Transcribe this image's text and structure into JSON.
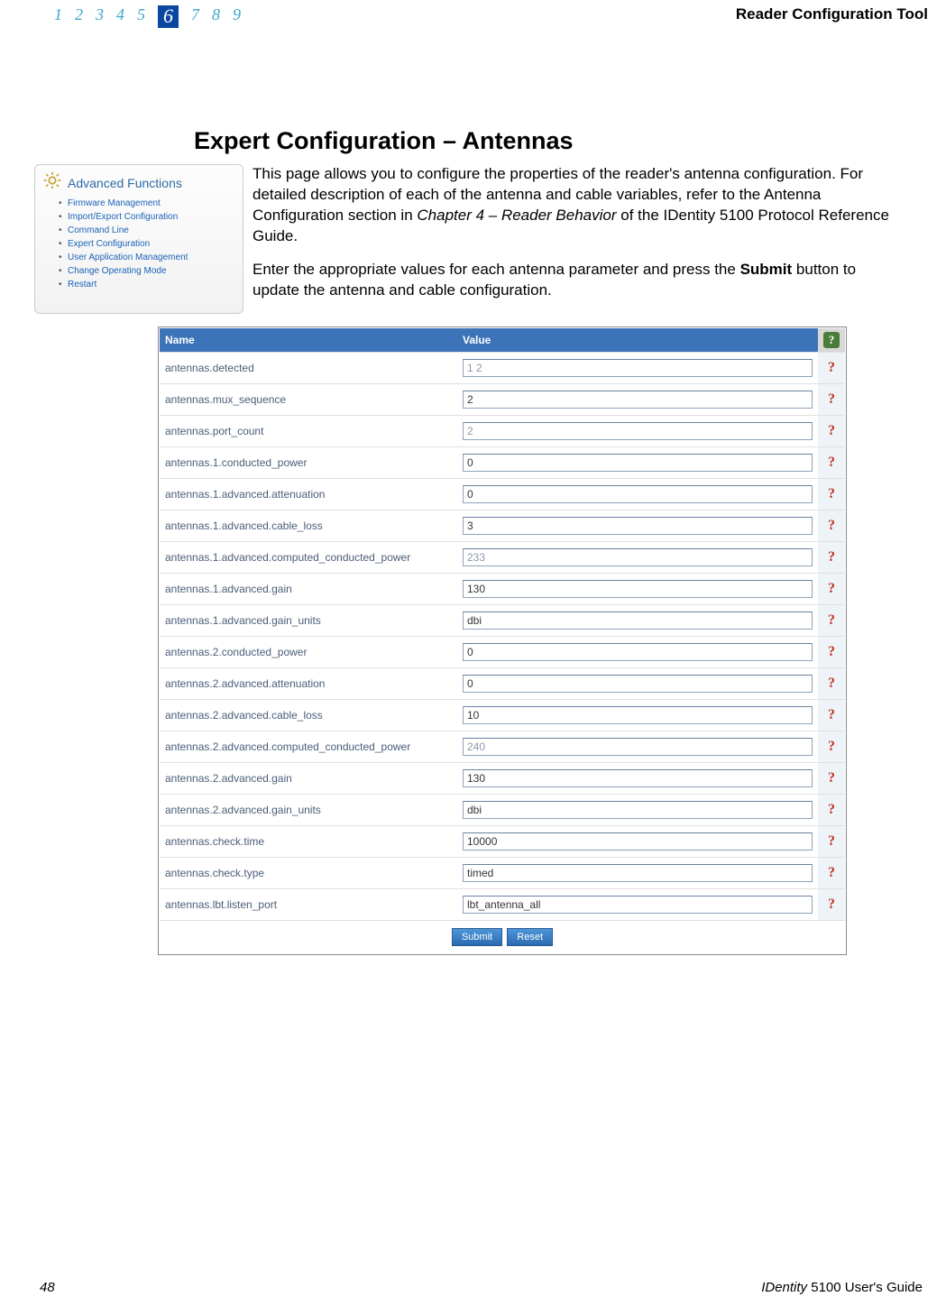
{
  "header": {
    "chapters": [
      "1",
      "2",
      "3",
      "4",
      "5",
      "6",
      "7",
      "8",
      "9"
    ],
    "current_chapter_index": 5,
    "title": "Reader Configuration Tool"
  },
  "section_title": "Expert Configuration – Antennas",
  "intro": {
    "p1_a": "This page allows you to configure the properties of the reader's antenna configuration. For detailed description of each of the antenna and cable variables, refer to the Antenna Configuration section in ",
    "p1_b": "Chapter 4 – Reader Behavior",
    "p1_c": " of the ",
    "p1_d": "IDentity 5100 Protocol Reference Guide",
    "p1_e": ".",
    "p2_a": "Enter the appropriate values for each antenna parameter and press the ",
    "p2_b": "Submit",
    "p2_c": " button to update the antenna and cable configuration."
  },
  "sidebar": {
    "title": "Advanced Functions",
    "items": [
      "Firmware Management",
      "Import/Export Configuration",
      "Command Line",
      "Expert Configuration",
      "User Application Management",
      "Change Operating Mode",
      "Restart"
    ]
  },
  "table": {
    "col_name": "Name",
    "col_value": "Value",
    "rows": [
      {
        "name": "antennas.detected",
        "value": "1 2",
        "readonly": true
      },
      {
        "name": "antennas.mux_sequence",
        "value": "2",
        "readonly": false
      },
      {
        "name": "antennas.port_count",
        "value": "2",
        "readonly": true
      },
      {
        "name": "antennas.1.conducted_power",
        "value": "0",
        "readonly": false
      },
      {
        "name": "antennas.1.advanced.attenuation",
        "value": "0",
        "readonly": false
      },
      {
        "name": "antennas.1.advanced.cable_loss",
        "value": "3",
        "readonly": false
      },
      {
        "name": "antennas.1.advanced.computed_conducted_power",
        "value": "233",
        "readonly": true
      },
      {
        "name": "antennas.1.advanced.gain",
        "value": "130",
        "readonly": false
      },
      {
        "name": "antennas.1.advanced.gain_units",
        "value": "dbi",
        "readonly": false
      },
      {
        "name": "antennas.2.conducted_power",
        "value": "0",
        "readonly": false
      },
      {
        "name": "antennas.2.advanced.attenuation",
        "value": "0",
        "readonly": false
      },
      {
        "name": "antennas.2.advanced.cable_loss",
        "value": "10",
        "readonly": false
      },
      {
        "name": "antennas.2.advanced.computed_conducted_power",
        "value": "240",
        "readonly": true
      },
      {
        "name": "antennas.2.advanced.gain",
        "value": "130",
        "readonly": false
      },
      {
        "name": "antennas.2.advanced.gain_units",
        "value": "dbi",
        "readonly": false
      },
      {
        "name": "antennas.check.time",
        "value": "10000",
        "readonly": false
      },
      {
        "name": "antennas.check.type",
        "value": "timed",
        "readonly": false
      },
      {
        "name": "antennas.lbt.listen_port",
        "value": "lbt_antenna_all",
        "readonly": false
      }
    ],
    "submit_label": "Submit",
    "reset_label": "Reset",
    "help_glyph": "?"
  },
  "footer": {
    "page_number": "48",
    "guide_a": "IDentity",
    "guide_b": " 5100 User's Guide"
  }
}
